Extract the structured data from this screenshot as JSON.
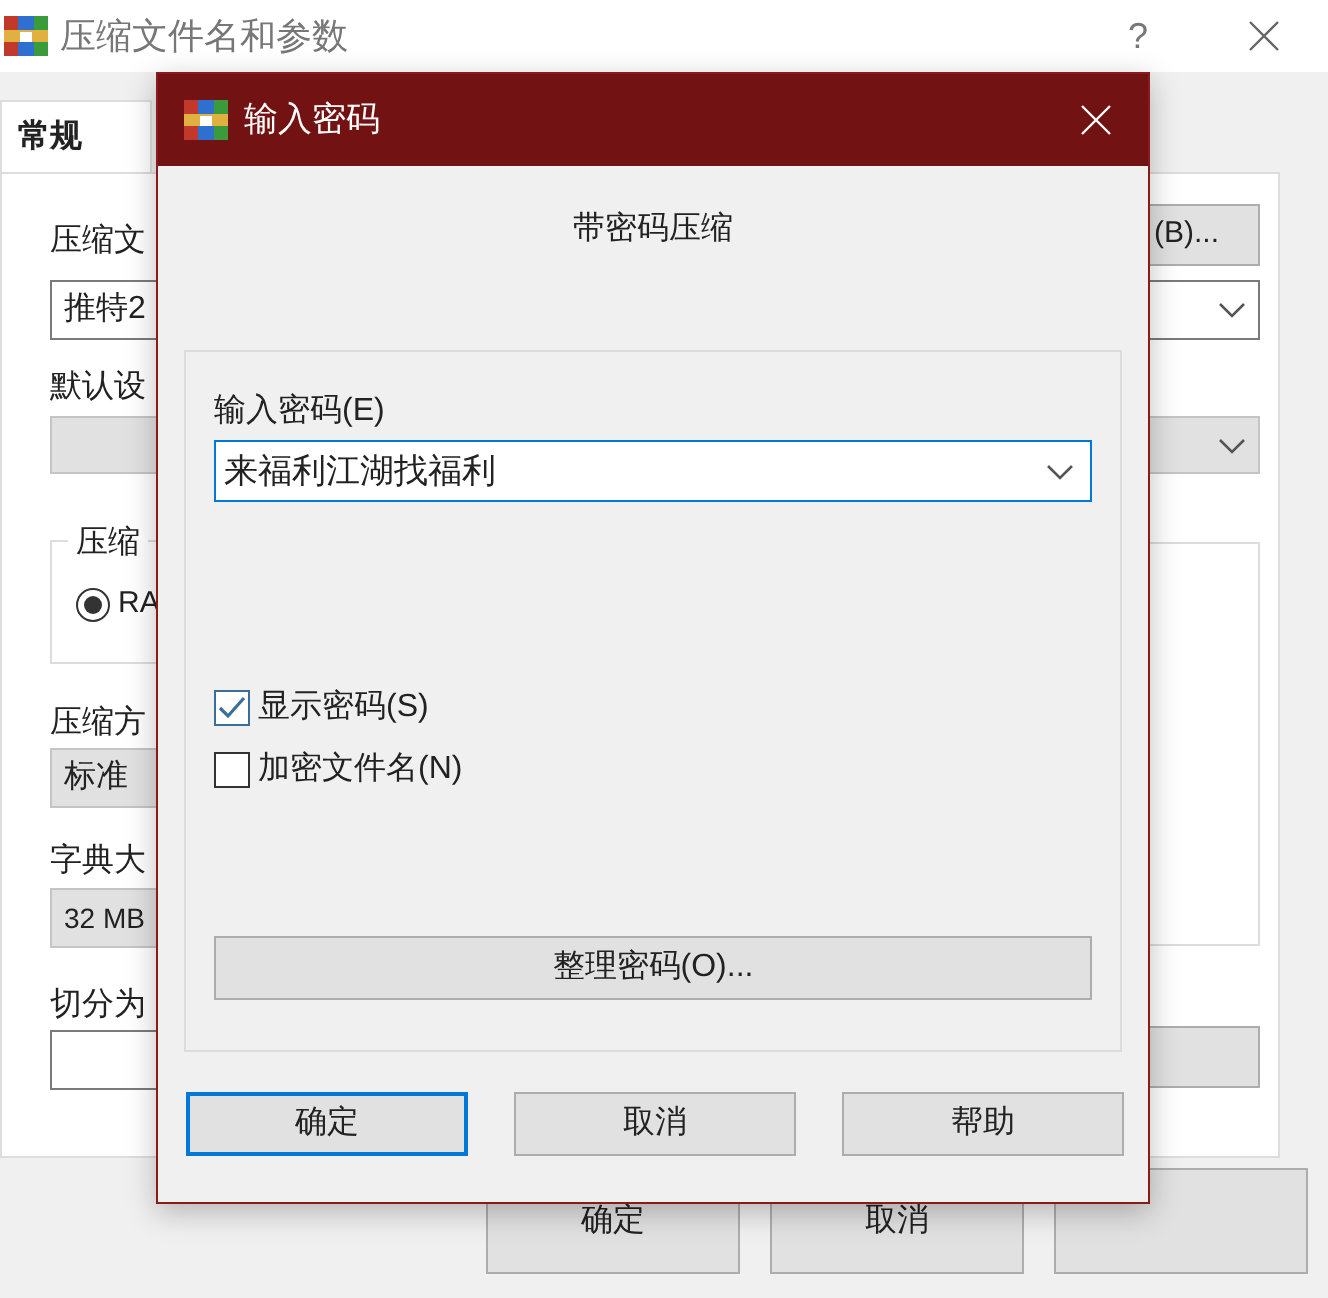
{
  "window": {
    "title": "压缩文件名和参数",
    "help_glyph": "?"
  },
  "tabs": [
    {
      "label": "常规",
      "selected": true
    }
  ],
  "general": {
    "archive_name_label": "压缩文",
    "archive_name": "推特2",
    "browse_button": "(B)...",
    "profile_label": "默认设",
    "format_group": "压缩",
    "format_option": {
      "label": "RA",
      "selected": true
    },
    "method_label": "压缩方",
    "method": "标准",
    "dictionary_label": "字典大",
    "dictionary": "32 MB",
    "split_label": "切分为"
  },
  "buttons": [
    {
      "label": "确定"
    },
    {
      "label": "取消"
    }
  ],
  "dialog": {
    "title": "输入密码",
    "heading": "带密码压缩",
    "password_label": "输入密码(E)",
    "password": "来福利江湖找福利",
    "options": [
      {
        "label": "显示密码(S)",
        "checked": true
      },
      {
        "label": "加密文件名(N)",
        "checked": false
      }
    ],
    "organize_button": "整理密码(O)...",
    "buttons": [
      {
        "label": "确定",
        "default": true
      },
      {
        "label": "取消",
        "default": false
      },
      {
        "label": "帮助",
        "default": false
      }
    ]
  }
}
